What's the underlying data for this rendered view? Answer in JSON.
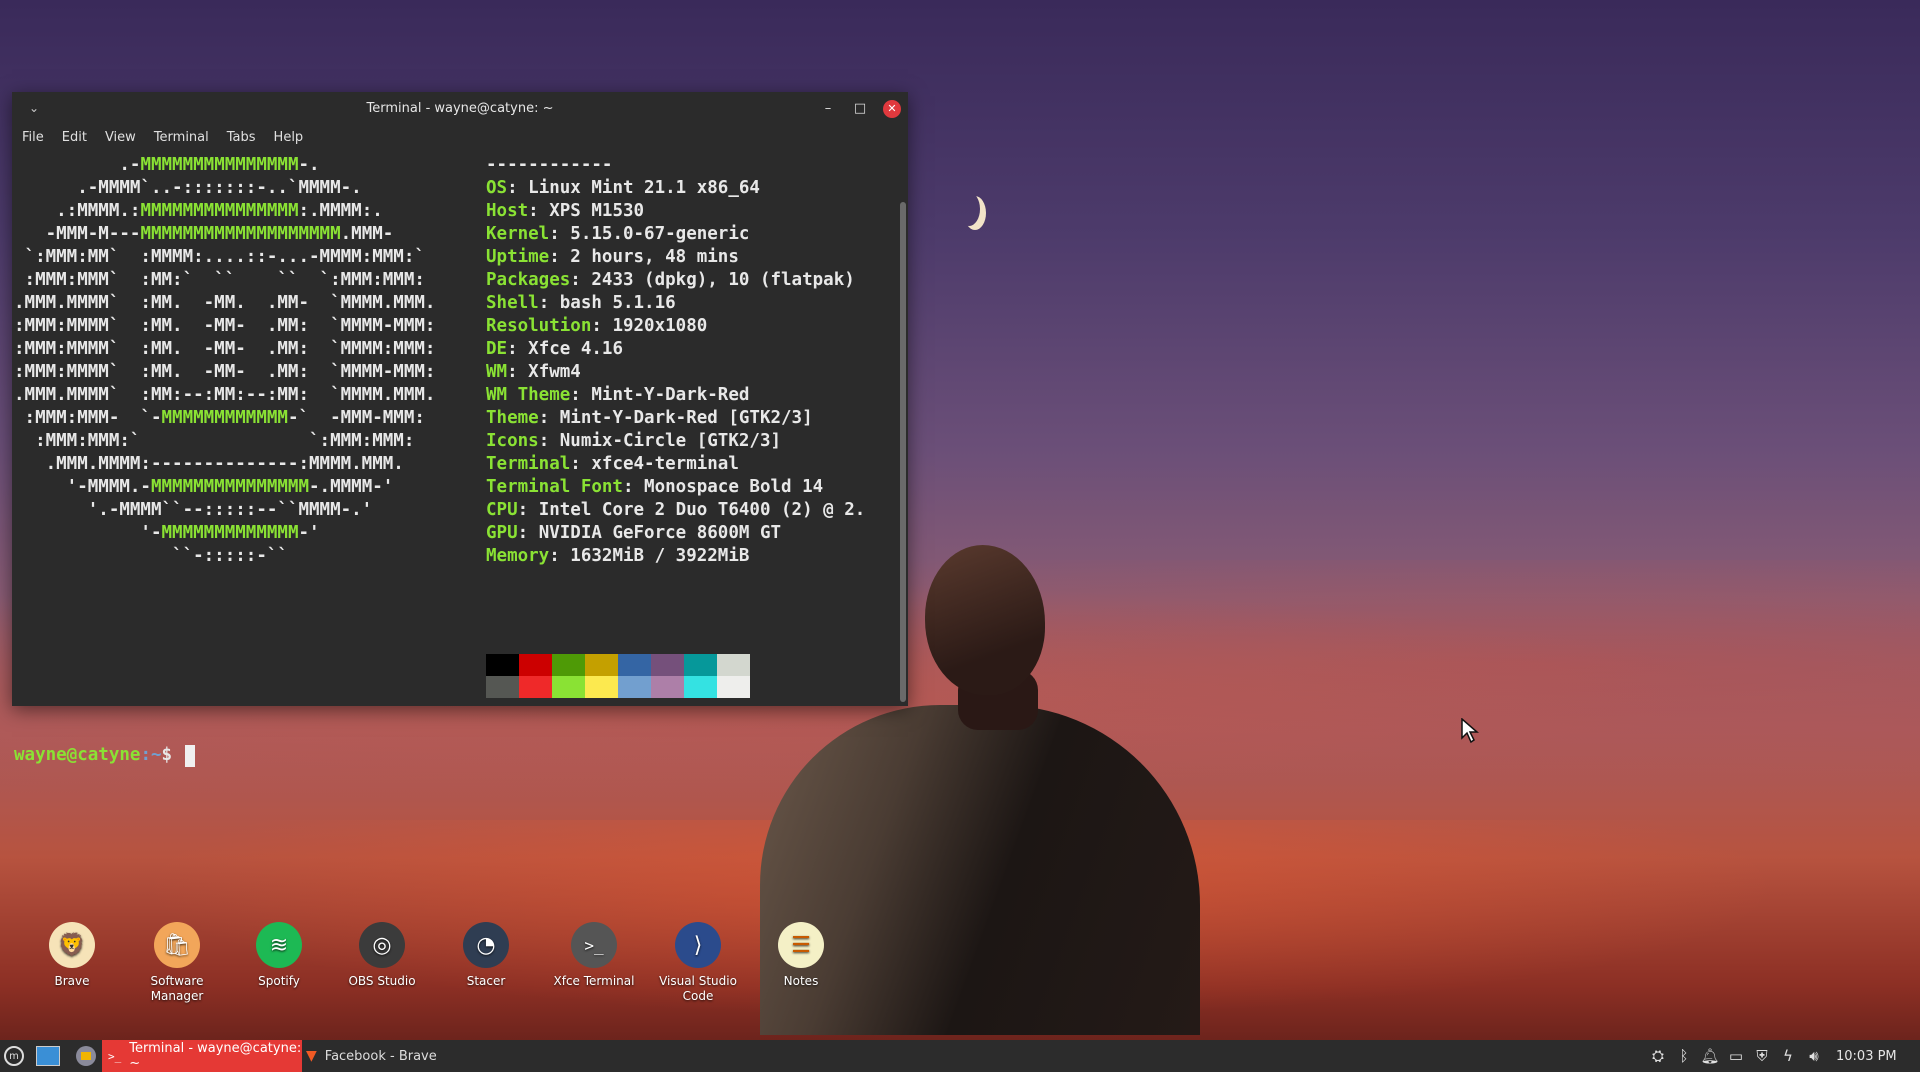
{
  "terminal": {
    "title": "Terminal - wayne@catyne: ~",
    "menu": [
      "File",
      "Edit",
      "View",
      "Terminal",
      "Tabs",
      "Help"
    ],
    "ascii": [
      "          .-MMMMMMMMMMMMMMM-.",
      "      .-MMMM`..-:::::::-..`MMMM-.",
      "    .:MMMM.:MMMMMMMMMMMMMMM:.MMMM:.",
      "   -MMM-M---MMMMMMMMMMMMMMMMMMM.MMM-",
      " `:MMM:MM`  :MMMM:....::-...-MMMM:MMM:`",
      " :MMM:MMM`  :MM:`  ``    ``  `:MMM:MMM:",
      ".MMM.MMMM`  :MM.  -MM.  .MM-  `MMMM.MMM.",
      ":MMM:MMMM`  :MM.  -MM-  .MM:  `MMMM-MMM:",
      ":MMM:MMMM`  :MM.  -MM-  .MM:  `MMMM:MMM:",
      ":MMM:MMMM`  :MM.  -MM-  .MM:  `MMMM-MMM:",
      ".MMM.MMMM`  :MM:--:MM:--:MM:  `MMMM.MMM.",
      " :MMM:MMM-  `-MMMMMMMMMMMM-`  -MMM-MMM:",
      "  :MMM:MMM:`                `:MMM:MMM:",
      "   .MMM.MMMM:--------------:MMMM.MMM.",
      "     '-MMMM.-MMMMMMMMMMMMMMM-.MMMM-'",
      "       '.-MMMM``--:::::--``MMMM-.'",
      "            '-MMMMMMMMMMMMM-'",
      "               ``-:::::-``"
    ],
    "separator": "------------",
    "info": [
      {
        "key": "OS",
        "value": "Linux Mint 21.1 x86_64"
      },
      {
        "key": "Host",
        "value": "XPS M1530"
      },
      {
        "key": "Kernel",
        "value": "5.15.0-67-generic"
      },
      {
        "key": "Uptime",
        "value": "2 hours, 48 mins"
      },
      {
        "key": "Packages",
        "value": "2433 (dpkg), 10 (flatpak)"
      },
      {
        "key": "Shell",
        "value": "bash 5.1.16"
      },
      {
        "key": "Resolution",
        "value": "1920x1080"
      },
      {
        "key": "DE",
        "value": "Xfce 4.16"
      },
      {
        "key": "WM",
        "value": "Xfwm4"
      },
      {
        "key": "WM Theme",
        "value": "Mint-Y-Dark-Red"
      },
      {
        "key": "Theme",
        "value": "Mint-Y-Dark-Red [GTK2/3]"
      },
      {
        "key": "Icons",
        "value": "Numix-Circle [GTK2/3]"
      },
      {
        "key": "Terminal",
        "value": "xfce4-terminal"
      },
      {
        "key": "Terminal Font",
        "value": "Monospace Bold 14"
      },
      {
        "key": "CPU",
        "value": "Intel Core 2 Duo T6400 (2) @ 2."
      },
      {
        "key": "GPU",
        "value": "NVIDIA GeForce 8600M GT"
      },
      {
        "key": "Memory",
        "value": "1632MiB / 3922MiB"
      }
    ],
    "palette_top": [
      "#000000",
      "#cc0000",
      "#4e9a06",
      "#c4a000",
      "#3465a4",
      "#75507b",
      "#06989a",
      "#d3d7cf"
    ],
    "palette_bottom": [
      "#555753",
      "#ef2929",
      "#8ae234",
      "#fce94f",
      "#729fcf",
      "#ad7fa8",
      "#34e2e2",
      "#eeeeec"
    ],
    "prompt_user": "wayne@catyne",
    "prompt_path": ":~",
    "prompt_symbol": "$"
  },
  "desktop_icons": [
    {
      "name": "Brave",
      "label": "Brave",
      "color": "#f6e3b8",
      "glyph": "🦁"
    },
    {
      "name": "Software Manager",
      "label": "Software Manager",
      "color": "#f2a65a",
      "glyph": "🛍"
    },
    {
      "name": "Spotify",
      "label": "Spotify",
      "color": "#1db954",
      "glyph": "≋"
    },
    {
      "name": "OBS Studio",
      "label": "OBS Studio",
      "color": "#3b3b3b",
      "glyph": "◎"
    },
    {
      "name": "Stacer",
      "label": "Stacer",
      "color": "#2f3d52",
      "glyph": "◔"
    },
    {
      "name": "Xfce Terminal",
      "label": "Xfce Terminal",
      "color": "#555555",
      "glyph": ">_"
    },
    {
      "name": "Visual Studio Code",
      "label": "Visual Studio Code",
      "color": "#2b4b8c",
      "glyph": "⟩"
    },
    {
      "name": "Notes",
      "label": "Notes",
      "color": "#f4f0c6",
      "glyph": "☰"
    }
  ],
  "taskbar": {
    "active_task": "Terminal - wayne@catyne: ~",
    "other_task": "Facebook - Brave",
    "clock": "10:03 PM"
  }
}
